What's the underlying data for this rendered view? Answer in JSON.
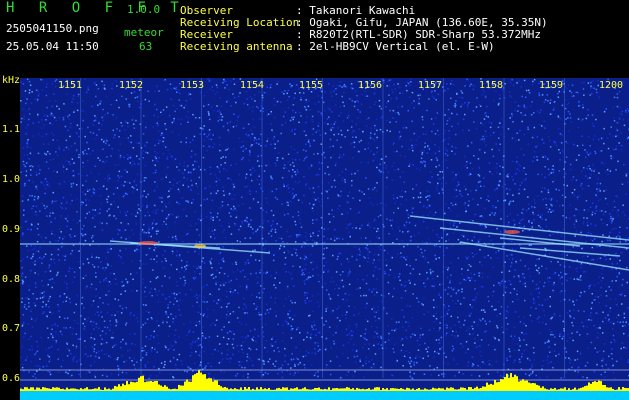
{
  "header": {
    "brand": "H R O F F T",
    "version": "1.0.0",
    "filename": "2505041150.png",
    "datetime": "25.05.04 11:50",
    "category_label": "meteor",
    "count": "63",
    "info_labels": [
      "Observer",
      "Receiving Location",
      "Receiver",
      "Receiving antenna"
    ],
    "info_values": [
      ": Takanori Kawachi",
      ": Ogaki, Gifu, JAPAN (136.60E, 35.35N)",
      ": R820T2(RTL-SDR) SDR-Sharp 53.372MHz",
      ": 2el-HB9CV Vertical (el. E-W)"
    ]
  },
  "axis": {
    "y_unit": "kHz",
    "y_ticks": [
      "1.1",
      "1.0",
      "0.9",
      "0.8",
      "0.7",
      "0.6"
    ],
    "x_ticks": [
      "1151",
      "1152",
      "1153",
      "1154",
      "1155",
      "1156",
      "1157",
      "1158",
      "1159",
      "1200"
    ]
  },
  "colors": {
    "background": "#000000",
    "spectrogram_base": "#0b1f8a",
    "header_text": "#33dd33",
    "label_text": "#ffffff",
    "tick_text": "#ffff44",
    "meteor_trace": "#9fe8ff",
    "level_bar": "#ffff00",
    "level_base": "#00ccff"
  }
}
